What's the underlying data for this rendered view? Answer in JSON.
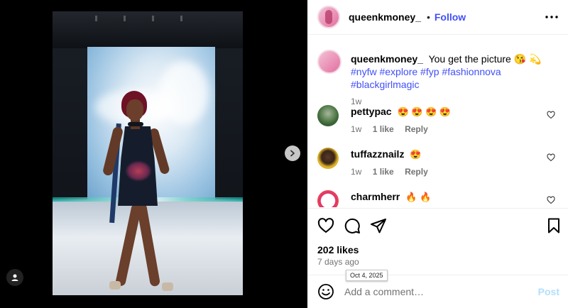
{
  "post": {
    "username": "queenkmoney_",
    "separator": "•",
    "follow_label": "Follow",
    "caption_text": "You get the picture 😘 💫",
    "hashtags": "#nyfw #explore #fyp #fashionnova #blackgirlmagic",
    "caption_age": "1w"
  },
  "comments": [
    {
      "username": "pettypac",
      "text": "😍 😍 😍 😍",
      "age": "1w",
      "likes": "1 like",
      "reply": "Reply",
      "avatar_color": "#3f6b3a"
    },
    {
      "username": "tuffazznailz",
      "text": "😍",
      "age": "1w",
      "likes": "1 like",
      "reply": "Reply",
      "avatar_color": "#e0b52a"
    },
    {
      "username": "charmherr",
      "text": "🔥 🔥",
      "avatar_color": "#e0306b"
    }
  ],
  "stats": {
    "likes": "202 likes",
    "time": "7 days ago",
    "tooltip": "Oct 4, 2025"
  },
  "composer": {
    "placeholder": "Add a comment…",
    "post_label": "Post"
  },
  "colors": {
    "link_blue": "#4150f7",
    "muted": "#737373",
    "post_disabled": "#b2dffc"
  },
  "icons": {
    "next": "chevron-right-icon",
    "tag": "user-tag-icon",
    "more": "more-horizontal-icon",
    "like": "heart-icon",
    "comment": "comment-icon",
    "share": "send-icon",
    "save": "bookmark-icon",
    "emoji": "emoji-icon"
  }
}
